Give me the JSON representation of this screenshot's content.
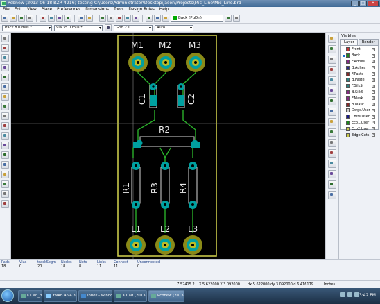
{
  "window": {
    "title": "Pcbnew (2013-06-18 BZR 4216)-testing C:\\Users\\Administrator\\Desktop\\Jason\\Projects\\Mic_Line\\Mic_Line.brd",
    "controls": [
      "_",
      "□",
      "✕"
    ]
  },
  "menu": [
    "File",
    "Edit",
    "View",
    "Place",
    "Preferences",
    "Dimensions",
    "Tools",
    "Design Rules",
    "Help"
  ],
  "toolbar": {
    "active_layer": "Back (PgDn)",
    "icons": [
      "new-board-icon",
      "open-icon",
      "save-icon",
      "page-settings-icon",
      "load-module-icon",
      "module-editor-icon",
      "undo-icon",
      "redo-icon",
      "print-icon",
      "plot-icon",
      "zoom-in-icon",
      "zoom-out-icon",
      "zoom-redraw-icon",
      "zoom-fit-icon",
      "find-icon",
      "netlist-icon",
      "drc-icon",
      "via-pair-icon",
      "autoplace-icon",
      "autoroute-icon"
    ]
  },
  "options": {
    "track": "Track 8.0 mils *",
    "via": "Via 35.0 mils *",
    "grid": "Grid 2.0",
    "zoom": "Auto"
  },
  "left_tools": [
    "drc-off-icon",
    "grid-icon",
    "polar-coords-icon",
    "inches-icon",
    "mm-icon",
    "cursor-shape-icon",
    "ratsnest-icon",
    "module-ratsnest-icon",
    "auto-delete-track-icon",
    "show-zones-icon",
    "zone-outline-icon",
    "zone-fill-icon",
    "pad-sketch-icon",
    "via-sketch-icon",
    "track-sketch-icon",
    "high-contrast-icon",
    "microwave-toolbar-icon",
    "layers-manager-icon"
  ],
  "right_tools": [
    "select-arrow-icon",
    "highlight-net-icon",
    "local-ratsnest-icon",
    "add-module-icon",
    "add-track-icon",
    "add-zone-icon",
    "add-keepout-icon",
    "add-line-icon",
    "add-circle-icon",
    "add-arc-icon",
    "add-text-icon",
    "add-dimension-icon",
    "add-target-icon",
    "delete-icon",
    "drill-offset-icon",
    "grid-origin-icon"
  ],
  "board": {
    "labels": {
      "M1": "M1",
      "M2": "M2",
      "M3": "M3",
      "C1": "C1",
      "C2": "C2",
      "R2": "R2",
      "R1": "R1",
      "R3": "R3",
      "R4": "R4",
      "L1": "L1",
      "L2": "L2",
      "L3": "L3"
    },
    "colors": {
      "copper": "#00a0a0",
      "pad": "#8a8a18",
      "pad_hole": "#bcbc28",
      "silk": "#d8d8d8",
      "outline": "#c8c84a",
      "track": "#2ab02a",
      "background": "#000000"
    }
  },
  "visibles": {
    "title": "Visibles",
    "tabs": [
      "Layer",
      "Render"
    ],
    "layers": [
      {
        "name": "Front",
        "color": "#c83232",
        "checked": true,
        "active": false
      },
      {
        "name": "Back",
        "color": "#1c8a1c",
        "checked": true,
        "active": true
      },
      {
        "name": "F.Adhes",
        "color": "#842a84",
        "checked": true,
        "active": false
      },
      {
        "name": "B.Adhes",
        "color": "#2a2a8a",
        "checked": true,
        "active": false
      },
      {
        "name": "F.Paste",
        "color": "#842a2a",
        "checked": true,
        "active": false
      },
      {
        "name": "B.Paste",
        "color": "#2a8484",
        "checked": true,
        "active": false
      },
      {
        "name": "F.SilkS",
        "color": "#2a8484",
        "checked": true,
        "active": false
      },
      {
        "name": "B.SilkS",
        "color": "#842a84",
        "checked": true,
        "active": false
      },
      {
        "name": "F.Mask",
        "color": "#842a84",
        "checked": true,
        "active": false
      },
      {
        "name": "B.Mask",
        "color": "#842a2a",
        "checked": true,
        "active": false
      },
      {
        "name": "Dwgs.User",
        "color": "#d0d0d0",
        "checked": true,
        "active": false
      },
      {
        "name": "Cmts.User",
        "color": "#1a1a8a",
        "checked": true,
        "active": false
      },
      {
        "name": "Eco1.User",
        "color": "#1c8a1c",
        "checked": true,
        "active": false
      },
      {
        "name": "Eco2.User",
        "color": "#c8c84a",
        "checked": true,
        "active": false
      },
      {
        "name": "Edge.Cuts",
        "color": "#c8c84a",
        "checked": true,
        "active": false
      }
    ]
  },
  "stats": [
    {
      "label": "Pads",
      "value": "18"
    },
    {
      "label": "Vias",
      "value": "0"
    },
    {
      "label": "trackSegm",
      "value": "20"
    },
    {
      "label": "Nodes",
      "value": "18"
    },
    {
      "label": "Nets",
      "value": "8"
    },
    {
      "label": "Links",
      "value": "11"
    },
    {
      "label": "Connect",
      "value": "11"
    },
    {
      "label": "Unconnected",
      "value": "0"
    }
  ],
  "statusline": {
    "zoom": "Z 52415.2",
    "xy": "X 5.622000  Y 3.092000",
    "dxdy": "dx 5.622000  dy 3.092000  d 6.416179",
    "units": "Inches"
  },
  "taskbar": {
    "items": [
      "KiCad_main_windo...",
      "YNAB 4 v4.3.3 (96 S...",
      "Inbox - Windows Liv...",
      "KiCad (2013-06-18...",
      "Pcbnew (2013-06-18..."
    ],
    "active_index": 4,
    "clock": "3:42 PM"
  }
}
